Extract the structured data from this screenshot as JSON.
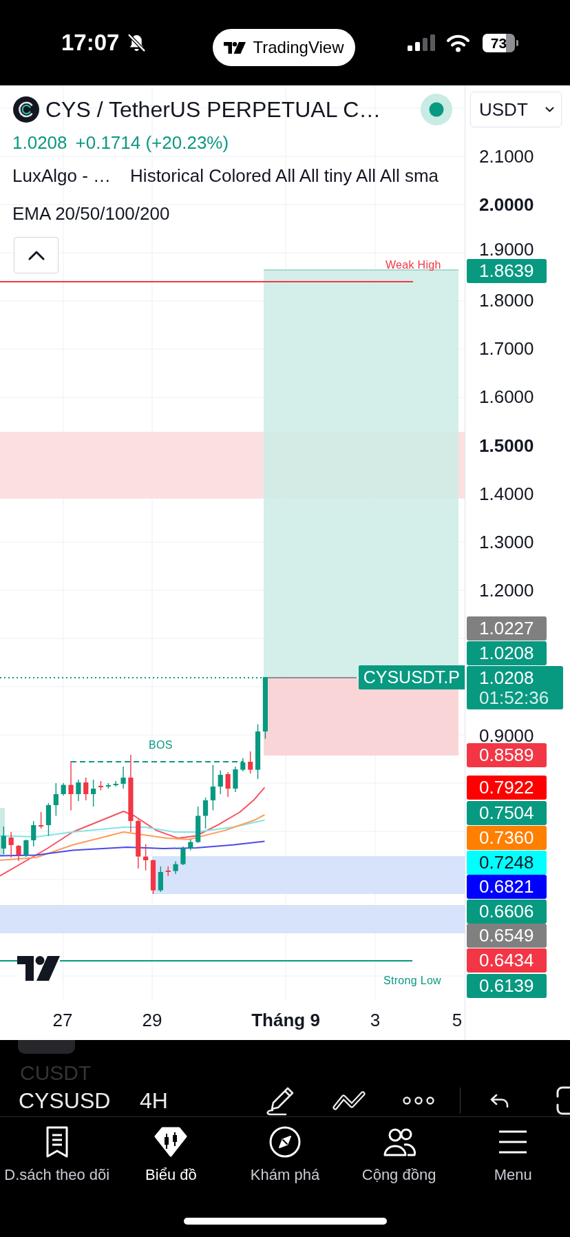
{
  "status_bar": {
    "time": "17:07",
    "muted": true,
    "app": "TradingView",
    "battery": "73"
  },
  "chart": {
    "symbol": {
      "title": "CYS / TetherUS PERPETUAL C…",
      "market_open": true
    },
    "currency": "USDT",
    "quote": {
      "price": "1.0208",
      "change": "+0.1714 (+20.23%)"
    },
    "indicators": [
      {
        "name": "LuxAlgo - …",
        "settings": "Historical Colored All All tiny All All sma"
      },
      {
        "name": "EMA 20/50/100/200"
      }
    ],
    "annotations": [
      {
        "kind": "weak_high",
        "label": "Weak High"
      },
      {
        "kind": "bos",
        "label": "BOS"
      },
      {
        "kind": "strong_low",
        "label": "Strong Low"
      }
    ],
    "symbol_tag": "CYSUSDT.P",
    "price_axis": {
      "ticks": [
        {
          "label": "2.1000",
          "major": false
        },
        {
          "label": "2.0000",
          "major": true
        },
        {
          "label": "1.9000",
          "major": false
        },
        {
          "label": "1.8000",
          "major": false
        },
        {
          "label": "1.7000",
          "major": false
        },
        {
          "label": "1.6000",
          "major": false
        },
        {
          "label": "1.5000",
          "major": true
        },
        {
          "label": "1.4000",
          "major": false
        },
        {
          "label": "1.3000",
          "major": false
        },
        {
          "label": "1.2000",
          "major": false
        },
        {
          "label": "0.9000",
          "major": false
        }
      ],
      "tags": [
        {
          "price": "1.8639",
          "color": "#089981"
        },
        {
          "price": "1.0227",
          "color": "#808080"
        },
        {
          "price": "1.0208",
          "color": "#089981"
        },
        {
          "price": "1.0208",
          "countdown": "01:52:36",
          "color": "#089981"
        },
        {
          "price": "0.8589",
          "color": "#f23645"
        },
        {
          "price": "0.7922",
          "color": "#ff0000"
        },
        {
          "price": "0.7504",
          "color": "#089981"
        },
        {
          "price": "0.7360",
          "color": "#ff7f00"
        },
        {
          "price": "0.7248",
          "color": "#00ffff"
        },
        {
          "price": "0.6821",
          "color": "#0000ff"
        },
        {
          "price": "0.6606",
          "color": "#089981"
        },
        {
          "price": "0.6549",
          "color": "#808080"
        },
        {
          "price": "0.6434",
          "color": "#f23645"
        },
        {
          "price": "0.6139",
          "color": "#089981"
        }
      ]
    },
    "time_axis": [
      {
        "label": "27",
        "major": false
      },
      {
        "label": "29",
        "major": false
      },
      {
        "label": "Tháng 9",
        "major": true
      },
      {
        "label": "3",
        "major": false
      },
      {
        "label": "5",
        "major": false
      }
    ]
  },
  "toolbar": {
    "faded_label": "CUSDT",
    "symbol": "CYSUSD",
    "interval": "4H"
  },
  "tabs": [
    {
      "label": "D.sách theo dõi",
      "selected": false
    },
    {
      "label": "Biểu đồ",
      "selected": true
    },
    {
      "label": "Khám phá",
      "selected": false
    },
    {
      "label": "Cộng đồng",
      "selected": false
    },
    {
      "label": "Menu",
      "selected": false
    }
  ]
}
